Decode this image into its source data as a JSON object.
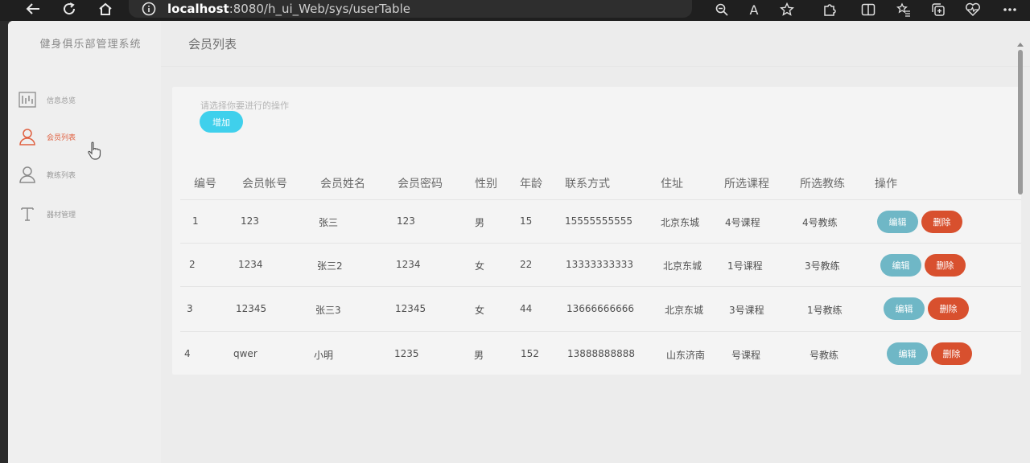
{
  "browser": {
    "url_host": "localhost",
    "url_rest": ":8080/h_ui_Web/sys/userTable",
    "font_scale_label": "A"
  },
  "sidebar": {
    "brand": "健身俱乐部管理系统",
    "items": [
      {
        "label": "信息总览",
        "icon": "dashboard-icon"
      },
      {
        "label": "会员列表",
        "icon": "user-icon",
        "active": true
      },
      {
        "label": "教练列表",
        "icon": "user-icon"
      },
      {
        "label": "器材管理",
        "icon": "text-icon"
      }
    ]
  },
  "main": {
    "title": "会员列表",
    "hint": "请选择你要进行的操作",
    "add_label": "增加"
  },
  "table": {
    "headers": [
      "编号",
      "会员帐号",
      "会员姓名",
      "会员密码",
      "性别",
      "年龄",
      "联系方式",
      "住址",
      "所选课程",
      "所选教练",
      "操作"
    ],
    "rows": [
      [
        "1",
        "123",
        "张三",
        "123",
        "男",
        "15",
        "15555555555",
        "北京东城",
        "4号课程",
        "4号教练"
      ],
      [
        "2",
        "1234",
        "张三2",
        "1234",
        "女",
        "22",
        "13333333333",
        "北京东城",
        "1号课程",
        "3号教练"
      ],
      [
        "3",
        "12345",
        "张三3",
        "12345",
        "女",
        "44",
        "13666666666",
        "北京东城",
        "3号课程",
        "1号教练"
      ],
      [
        "4",
        "qwer",
        "小明",
        "1235",
        "男",
        "152",
        "13888888888",
        "山东济南",
        "号课程",
        "号教练"
      ]
    ],
    "edit_label": "编辑",
    "delete_label": "删除"
  },
  "colors": {
    "accent_cyan": "#3fd0ec",
    "edit_teal": "#6fb7c6",
    "delete_red": "#d8502e",
    "active_orange": "#e06040"
  }
}
